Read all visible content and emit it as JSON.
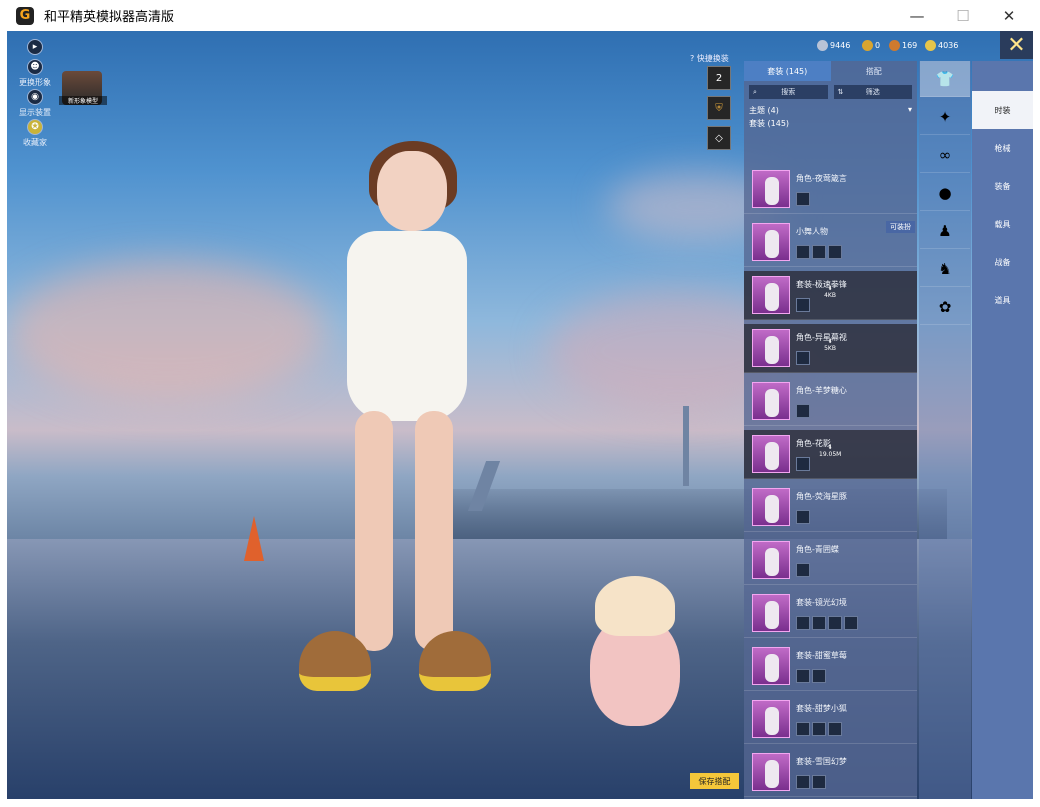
{
  "window": {
    "title": "和平精英模拟器高清版",
    "app_icon": "G",
    "minimize": "—",
    "maximize": "☐",
    "close": "✕"
  },
  "left_menu": [
    {
      "label": "",
      "icon": "play-icon",
      "glyph": "▸"
    },
    {
      "label": "更换形象",
      "icon": "person-icon",
      "glyph": "☻"
    },
    {
      "label": "显示装置",
      "icon": "eye-icon",
      "glyph": "◉"
    },
    {
      "label": "收藏家",
      "icon": "collector-icon",
      "glyph": "✪"
    }
  ],
  "avatar_label": "新形象模型",
  "quick_switch": {
    "label": "快捷换装",
    "help": "?",
    "buttons": [
      {
        "icon": "outfit-2-icon",
        "glyph": "2"
      },
      {
        "icon": "shield-icon",
        "glyph": "⛨"
      },
      {
        "icon": "diamond-icon",
        "glyph": "◇"
      }
    ]
  },
  "currencies": [
    {
      "value": "9446",
      "color": "#b9c3d6"
    },
    {
      "value": "0",
      "color": "#d8a530"
    },
    {
      "value": "169",
      "color": "#cf7a2e"
    },
    {
      "value": "4036",
      "color": "#e6c54a"
    }
  ],
  "close_button": "✕",
  "panel": {
    "tabs": [
      {
        "label": "套装 (145)",
        "active": true
      },
      {
        "label": "搭配",
        "active": false
      }
    ],
    "search": "搜索",
    "filter": "筛选",
    "theme_header": "主题 (4)",
    "suit_header": "套装 (145)",
    "dropdown": "▾",
    "items": [
      {
        "name": "角色-夜莺箴言",
        "dark": false,
        "subs": 1,
        "badge": "",
        "dl": ""
      },
      {
        "name": "小舞人物",
        "dark": false,
        "subs": 3,
        "badge": "可装扮",
        "dl": ""
      },
      {
        "name": "套装-极速拳锋",
        "dark": true,
        "subs": 1,
        "badge": "",
        "dl": "4KB"
      },
      {
        "name": "角色-异星幕视",
        "dark": true,
        "subs": 1,
        "badge": "",
        "dl": "5KB"
      },
      {
        "name": "角色-羊梦糖心",
        "dark": false,
        "subs": 1,
        "badge": "",
        "dl": ""
      },
      {
        "name": "角色-花影",
        "dark": true,
        "subs": 1,
        "badge": "",
        "dl": "19.05M"
      },
      {
        "name": "角色-荧海星豚",
        "dark": false,
        "subs": 1,
        "badge": "",
        "dl": ""
      },
      {
        "name": "角色-青囲蝶",
        "dark": false,
        "subs": 1,
        "badge": "",
        "dl": ""
      },
      {
        "name": "套装-镜光幻境",
        "dark": false,
        "subs": 4,
        "badge": "",
        "dl": ""
      },
      {
        "name": "套装-甜蜜草莓",
        "dark": false,
        "subs": 2,
        "badge": "",
        "dl": ""
      },
      {
        "name": "套装-甜梦小狐",
        "dark": false,
        "subs": 3,
        "badge": "",
        "dl": ""
      },
      {
        "name": "套装-雪国幻梦",
        "dark": false,
        "subs": 2,
        "badge": "",
        "dl": ""
      }
    ]
  },
  "categories": [
    {
      "icon": "outfit-icon",
      "glyph": "👕",
      "active": true
    },
    {
      "icon": "gun-icon",
      "glyph": "✦",
      "active": false
    },
    {
      "icon": "glasses-icon",
      "glyph": "∞",
      "active": false
    },
    {
      "icon": "ball-icon",
      "glyph": "●",
      "active": false
    },
    {
      "icon": "figure-icon",
      "glyph": "♟",
      "active": false
    },
    {
      "icon": "pose-icon",
      "glyph": "♞",
      "active": false
    },
    {
      "icon": "toy-icon",
      "glyph": "✿",
      "active": false
    }
  ],
  "side_menu": [
    {
      "label": "时装",
      "active": true
    },
    {
      "label": "枪械",
      "active": false
    },
    {
      "label": "装备",
      "active": false
    },
    {
      "label": "载具",
      "active": false
    },
    {
      "label": "战备",
      "active": false
    },
    {
      "label": "道具",
      "active": false
    }
  ],
  "save_button": "保存搭配"
}
